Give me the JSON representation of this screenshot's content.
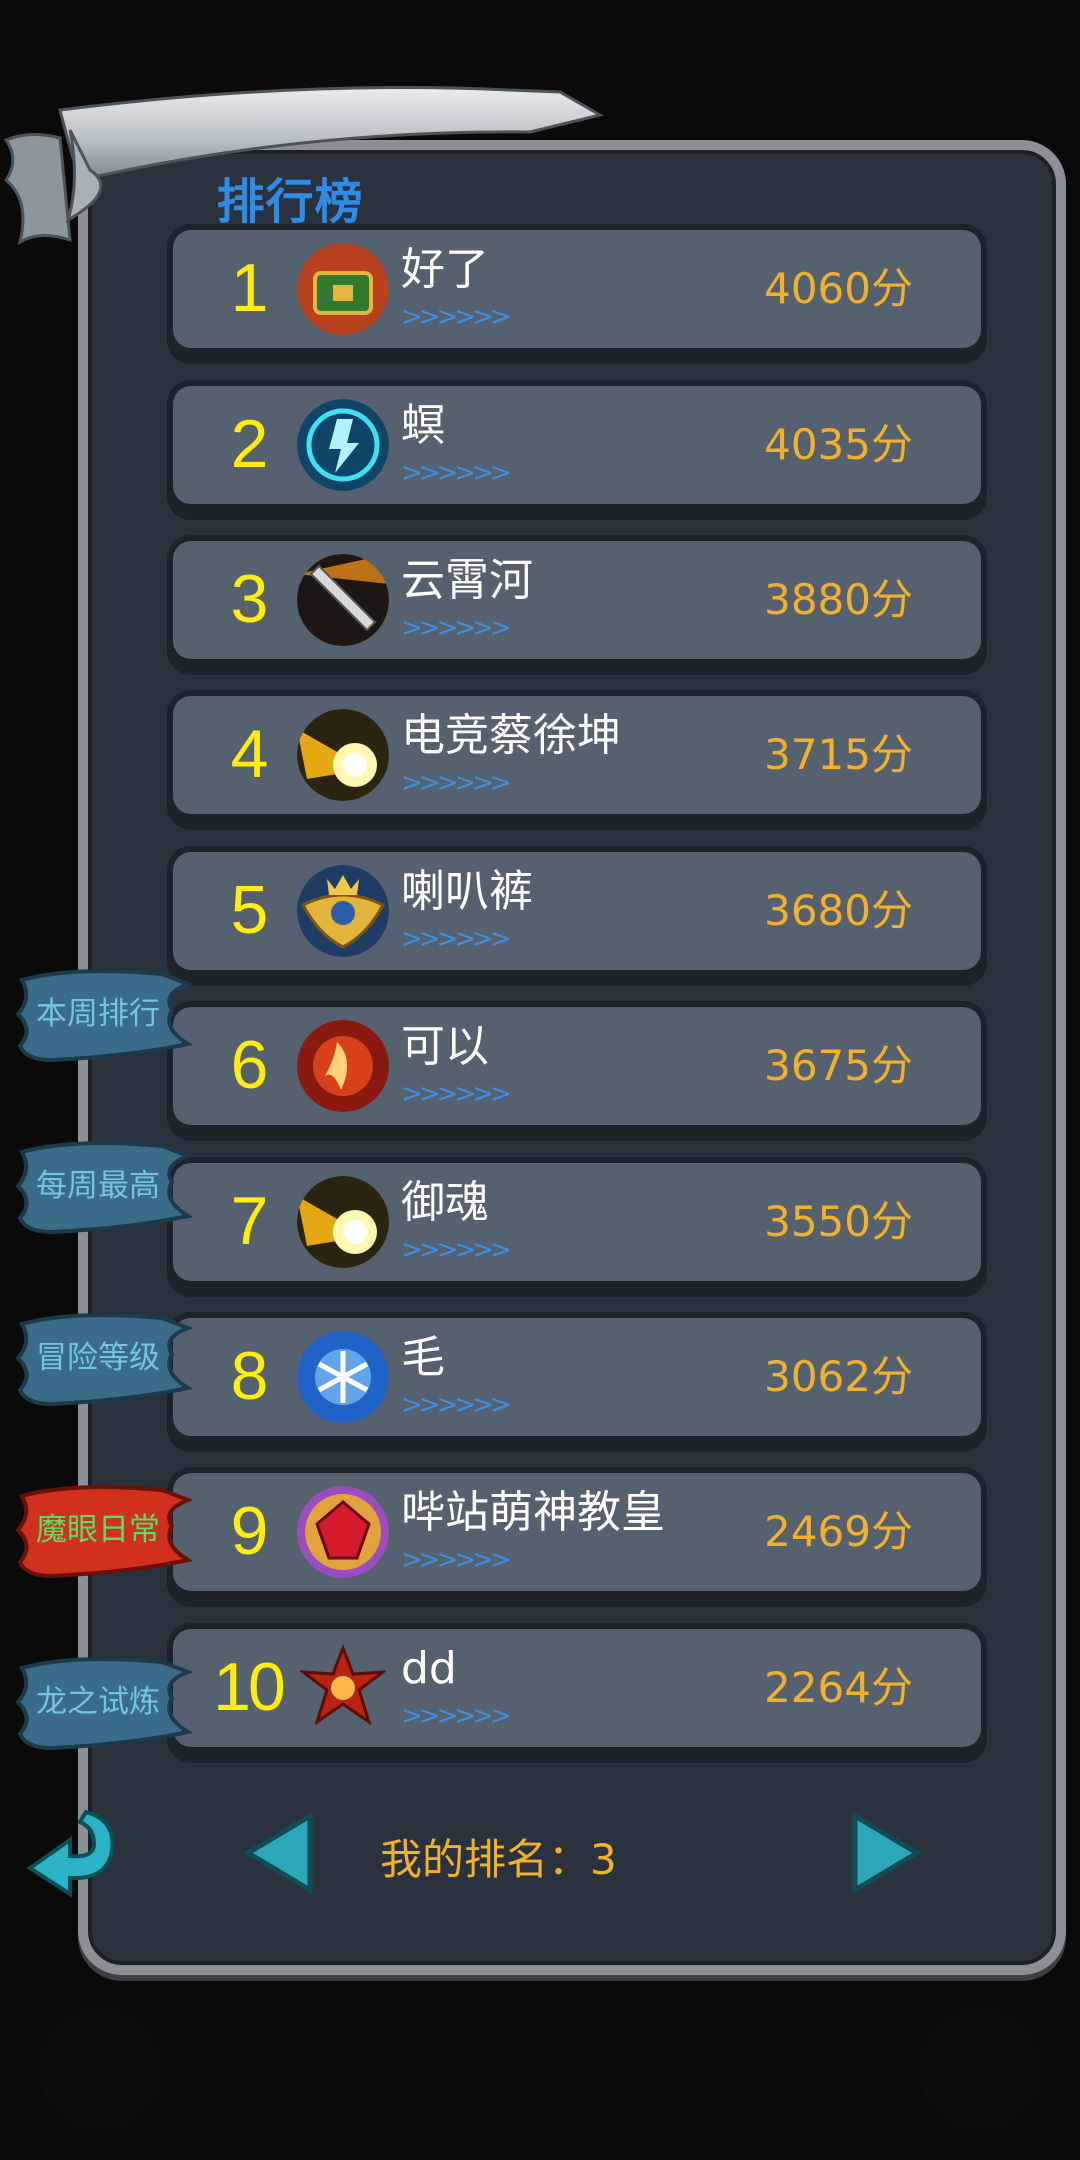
{
  "title": "排行榜",
  "tabs": [
    {
      "label": "本周排行",
      "color": "#72c7dc",
      "active": false
    },
    {
      "label": "每周最高",
      "color": "#72c7dc",
      "active": false
    },
    {
      "label": "冒险等级",
      "color": "#72c7dc",
      "active": false
    },
    {
      "label": "魔眼日常",
      "color": "#59e064",
      "active": true
    },
    {
      "label": "龙之试炼",
      "color": "#72c7dc",
      "active": false
    }
  ],
  "leaderboard": [
    {
      "rank": "1",
      "name": "好了",
      "score": "4060分",
      "chevrons": ">>>>>>",
      "avatar": "treasure-chest-icon"
    },
    {
      "rank": "2",
      "name": "螟",
      "score": "4035分",
      "chevrons": ">>>>>>",
      "avatar": "lightning-shield-icon"
    },
    {
      "rank": "3",
      "name": "云霄河",
      "score": "3880分",
      "chevrons": ">>>>>>",
      "avatar": "sword-icon"
    },
    {
      "rank": "4",
      "name": "电竞蔡徐坤",
      "score": "3715分",
      "chevrons": ">>>>>>",
      "avatar": "light-burst-icon"
    },
    {
      "rank": "5",
      "name": "喇叭裤",
      "score": "3680分",
      "chevrons": ">>>>>>",
      "avatar": "winged-emblem-icon"
    },
    {
      "rank": "6",
      "name": "可以",
      "score": "3675分",
      "chevrons": ">>>>>>",
      "avatar": "fire-figure-icon"
    },
    {
      "rank": "7",
      "name": "御魂",
      "score": "3550分",
      "chevrons": ">>>>>>",
      "avatar": "light-burst-icon"
    },
    {
      "rank": "8",
      "name": "毛",
      "score": "3062分",
      "chevrons": ">>>>>>",
      "avatar": "snowflake-icon"
    },
    {
      "rank": "9",
      "name": "哔站萌神教皇",
      "score": "2469分",
      "chevrons": ">>>>>>",
      "avatar": "red-gem-icon"
    },
    {
      "rank": "10",
      "name": "dd",
      "score": "2264分",
      "chevrons": ">>>>>>",
      "avatar": "fire-star-icon"
    }
  ],
  "my_rank": "我的排名：3",
  "colors": {
    "rank": "#ffee0a",
    "score": "#f3b12a",
    "title": "#2e8ce6",
    "arrow": "#2ab4c6"
  }
}
